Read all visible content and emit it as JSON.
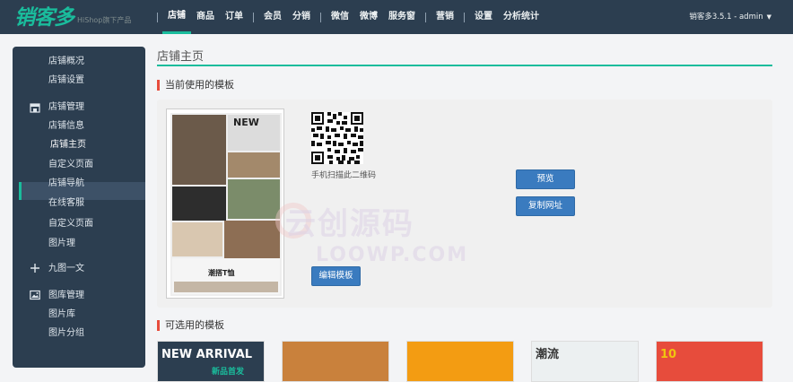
{
  "header": {
    "logo_text": "销客多",
    "logo_sub": "HiShop旗下产品",
    "nav": [
      "店铺",
      "商品",
      "订单",
      "会员",
      "分销",
      "微信",
      "微博",
      "服务窗",
      "营销",
      "设置",
      "分析统计"
    ],
    "user": "销客多3.5.1 - admin"
  },
  "sidebar": {
    "items": {
      "overview": "店铺概况",
      "settings": "店铺设置",
      "group_manage": "店铺管理",
      "info": "店铺信息",
      "home": "店铺主页",
      "custom_page": "自定义页面",
      "navigation": "店铺导航",
      "online_customer": "在线客服",
      "custom_page2": "自定义页面",
      "image_manage_short": "图片理",
      "jiutu": "九图一文",
      "group_image": "图库管理",
      "image_lib": "图片库",
      "image_group": "图片分组"
    }
  },
  "main": {
    "page_title": "店铺主页",
    "current_section": "当前使用的模板",
    "available_section": "可选用的模板",
    "qr_label": "手机扫描此二维码",
    "preview_button": "预览",
    "copy_button": "复制网址",
    "edit_button": "编辑模板",
    "template_text": {
      "new": "NEW",
      "tshirt": "潮搭T恤"
    },
    "watermark": "云创源码",
    "watermark_url": "LOOWP.COM"
  },
  "thumbs": [
    {
      "caption": "NEW ARRIVAL",
      "sub": "新品首发",
      "bg": "#2c3e50",
      "color": "#ffffff"
    },
    {
      "caption": "",
      "sub": "",
      "bg": "#c9813c",
      "color": "#ffffff"
    },
    {
      "caption": "",
      "sub": "",
      "bg": "#f39c12",
      "color": "#ffffff"
    },
    {
      "caption": "潮流",
      "sub": "",
      "bg": "#ecf0f1",
      "color": "#333333"
    },
    {
      "caption": "10",
      "sub": "",
      "bg": "#e74c3c",
      "color": "#f1c40f"
    }
  ],
  "colors": {
    "topbar": "#2c3e50",
    "accent": "#1abc9c",
    "button": "#3a7bbf",
    "section_marker": "#e74c3c"
  }
}
